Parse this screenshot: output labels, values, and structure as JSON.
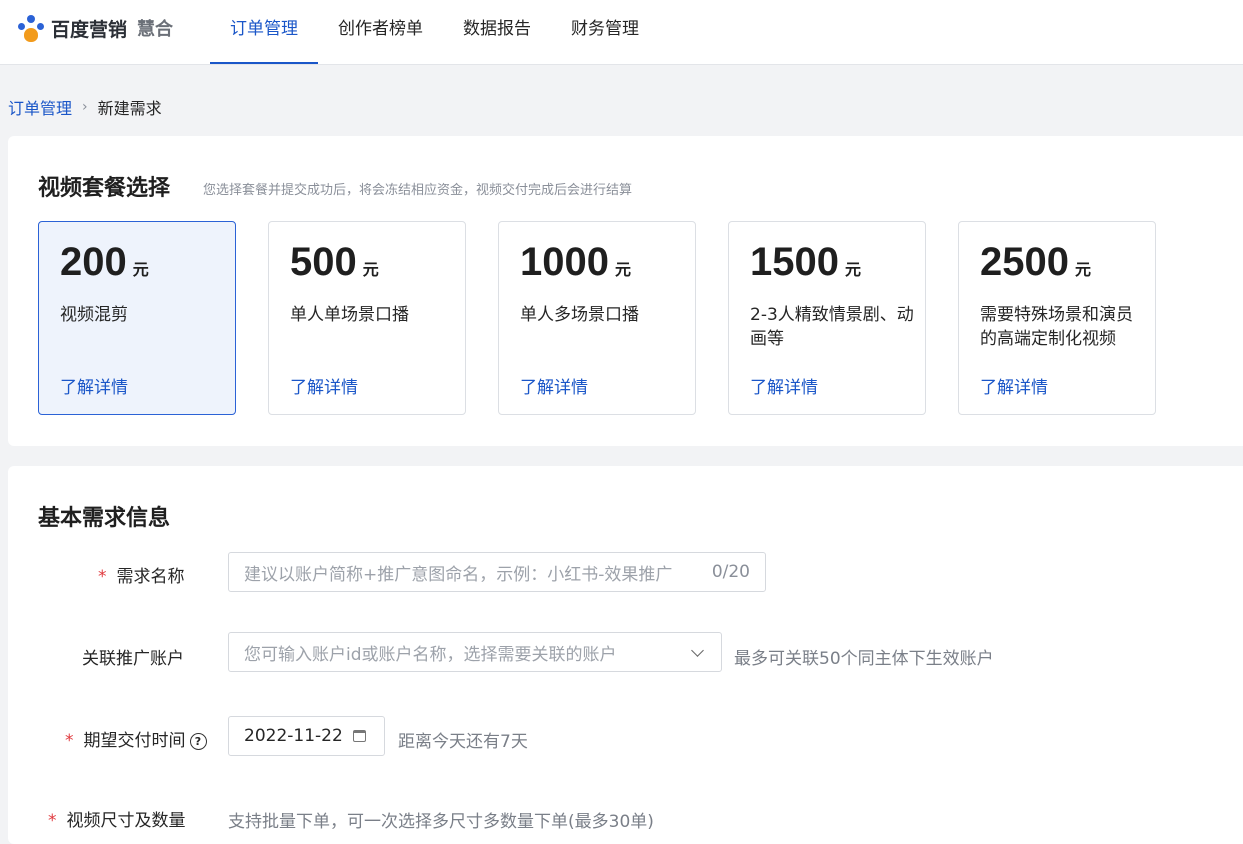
{
  "brand": {
    "name": "百度营销",
    "sub": "慧合"
  },
  "nav": [
    {
      "label": "订单管理",
      "active": true
    },
    {
      "label": "创作者榜单",
      "active": false
    },
    {
      "label": "数据报告",
      "active": false
    },
    {
      "label": "财务管理",
      "active": false
    }
  ],
  "breadcrumb": {
    "parent": "订单管理",
    "sep": "›",
    "current": "新建需求"
  },
  "packages": {
    "title": "视频套餐选择",
    "hint": "您选择套餐并提交成功后，将会冻结相应资金，视频交付完成后会进行结算",
    "items": [
      {
        "price": "200",
        "unit": "元",
        "desc": "视频混剪",
        "link": "了解详情",
        "selected": true
      },
      {
        "price": "500",
        "unit": "元",
        "desc": "单人单场景口播",
        "link": "了解详情",
        "selected": false
      },
      {
        "price": "1000",
        "unit": "元",
        "desc": "单人多场景口播",
        "link": "了解详情",
        "selected": false
      },
      {
        "price": "1500",
        "unit": "元",
        "desc": "2-3人精致情景剧、动画等",
        "link": "了解详情",
        "selected": false
      },
      {
        "price": "2500",
        "unit": "元",
        "desc": "需要特殊场景和演员的高端定制化视频",
        "link": "了解详情",
        "selected": false
      }
    ]
  },
  "form": {
    "title": "基本需求信息",
    "required_mark": "*",
    "name": {
      "label": "需求名称",
      "placeholder": "建议以账户简称+推广意图命名，示例：小红书-效果推广",
      "count": "0/20"
    },
    "account": {
      "label": "关联推广账户",
      "placeholder": "您可输入账户id或账户名称，选择需要关联的账户",
      "note": "最多可关联50个同主体下生效账户"
    },
    "delivery": {
      "label": "期望交付时间",
      "help": "?",
      "value": "2022-11-22",
      "note": "距离今天还有7天"
    },
    "size": {
      "label": "视频尺寸及数量",
      "note": "支持批量下单，可一次选择多尺寸多数量下单(最多30单)"
    }
  },
  "colors": {
    "accent": "#1a56c8",
    "required": "#e0393e",
    "selected_bg": "#eef3fc"
  }
}
